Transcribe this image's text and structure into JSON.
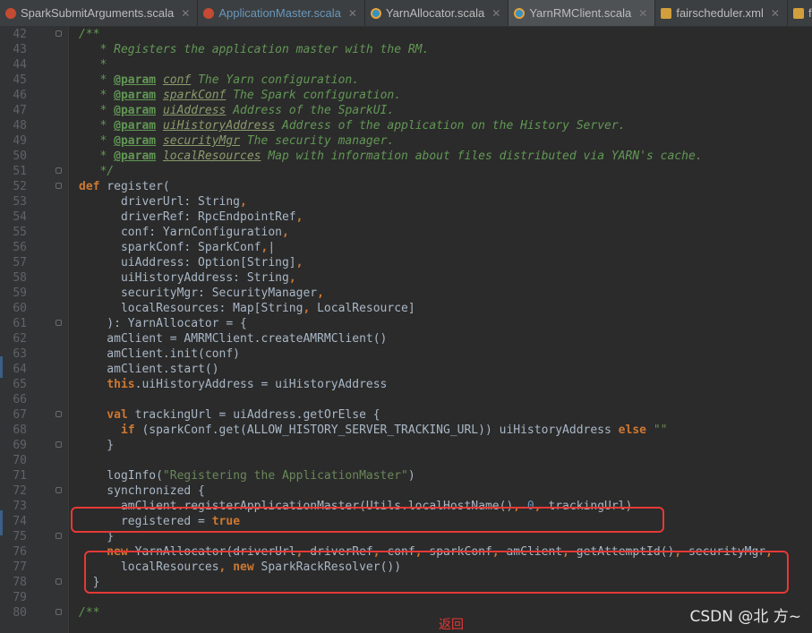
{
  "tabs": [
    {
      "label": "SparkSubmitArguments.scala",
      "icon": "scala-file-icon",
      "active": false,
      "modified": false
    },
    {
      "label": "ApplicationMaster.scala",
      "icon": "scala-file-icon",
      "active": false,
      "modified": true
    },
    {
      "label": "YarnAllocator.scala",
      "icon": "scala-class-icon",
      "active": false,
      "modified": false
    },
    {
      "label": "YarnRMClient.scala",
      "icon": "scala-class-icon",
      "active": true,
      "modified": false
    },
    {
      "label": "fairscheduler.xml",
      "icon": "xml-file-icon",
      "active": false,
      "modified": false
    },
    {
      "label": "fairsche",
      "icon": "xml-file-icon",
      "active": false,
      "modified": false
    }
  ],
  "close_glyph": "✕",
  "code_lines": [
    {
      "n": "42",
      "t": [
        [
          "doc",
          "/**"
        ]
      ],
      "fold": true
    },
    {
      "n": "43",
      "t": [
        [
          "doc",
          "   * Registers the application master with the RM."
        ]
      ]
    },
    {
      "n": "44",
      "t": [
        [
          "doc",
          "   *"
        ]
      ]
    },
    {
      "n": "45",
      "t": [
        [
          "doc",
          "   * "
        ],
        [
          "tag",
          "@param"
        ],
        [
          "doc",
          " "
        ],
        [
          "dref",
          "conf"
        ],
        [
          "doc",
          " The Yarn configuration."
        ]
      ]
    },
    {
      "n": "46",
      "t": [
        [
          "doc",
          "   * "
        ],
        [
          "tag",
          "@param"
        ],
        [
          "doc",
          " "
        ],
        [
          "dref",
          "sparkConf"
        ],
        [
          "doc",
          " The Spark configuration."
        ]
      ]
    },
    {
      "n": "47",
      "t": [
        [
          "doc",
          "   * "
        ],
        [
          "tag",
          "@param"
        ],
        [
          "doc",
          " "
        ],
        [
          "dref",
          "uiAddress"
        ],
        [
          "doc",
          " Address of the SparkUI."
        ]
      ]
    },
    {
      "n": "48",
      "t": [
        [
          "doc",
          "   * "
        ],
        [
          "tag",
          "@param"
        ],
        [
          "doc",
          " "
        ],
        [
          "dref",
          "uiHistoryAddress"
        ],
        [
          "doc",
          " Address of the application on the History Server."
        ]
      ]
    },
    {
      "n": "49",
      "t": [
        [
          "doc",
          "   * "
        ],
        [
          "tag",
          "@param"
        ],
        [
          "doc",
          " "
        ],
        [
          "dref",
          "securityMgr"
        ],
        [
          "doc",
          " The security manager."
        ]
      ]
    },
    {
      "n": "50",
      "t": [
        [
          "doc",
          "   * "
        ],
        [
          "tag",
          "@param"
        ],
        [
          "doc",
          " "
        ],
        [
          "dref",
          "localResources"
        ],
        [
          "doc",
          " Map with information about files distributed via YARN's cache."
        ]
      ]
    },
    {
      "n": "51",
      "t": [
        [
          "doc",
          "   */"
        ]
      ],
      "fold": true
    },
    {
      "n": "52",
      "t": [
        [
          "kw",
          "def"
        ],
        [
          "p",
          " register("
        ]
      ],
      "fold": true
    },
    {
      "n": "53",
      "t": [
        [
          "p",
          "      driverUrl: String"
        ],
        [
          "kw",
          ","
        ]
      ]
    },
    {
      "n": "54",
      "t": [
        [
          "p",
          "      driverRef: RpcEndpointRef"
        ],
        [
          "kw",
          ","
        ]
      ]
    },
    {
      "n": "55",
      "t": [
        [
          "p",
          "      conf: YarnConfiguration"
        ],
        [
          "kw",
          ","
        ]
      ]
    },
    {
      "n": "56",
      "t": [
        [
          "p",
          "      sparkConf: SparkConf"
        ],
        [
          "kw",
          ","
        ],
        [
          "p",
          "|"
        ]
      ]
    },
    {
      "n": "57",
      "t": [
        [
          "p",
          "      uiAddress: Option[String]"
        ],
        [
          "kw",
          ","
        ]
      ]
    },
    {
      "n": "58",
      "t": [
        [
          "p",
          "      uiHistoryAddress: String"
        ],
        [
          "kw",
          ","
        ]
      ]
    },
    {
      "n": "59",
      "t": [
        [
          "p",
          "      securityMgr: SecurityManager"
        ],
        [
          "kw",
          ","
        ]
      ]
    },
    {
      "n": "60",
      "t": [
        [
          "p",
          "      localResources: Map[String"
        ],
        [
          "kw",
          ","
        ],
        [
          "p",
          " LocalResource]"
        ]
      ]
    },
    {
      "n": "61",
      "t": [
        [
          "p",
          "    ): YarnAllocator = {"
        ]
      ],
      "fold": true
    },
    {
      "n": "62",
      "t": [
        [
          "p",
          "    amClient = AMRMClient.createAMRMClient()"
        ]
      ]
    },
    {
      "n": "63",
      "t": [
        [
          "p",
          "    amClient.init(conf)"
        ]
      ]
    },
    {
      "n": "64",
      "t": [
        [
          "p",
          "    amClient.start()"
        ]
      ]
    },
    {
      "n": "65",
      "t": [
        [
          "kw",
          "    this"
        ],
        [
          "p",
          ".uiHistoryAddress = uiHistoryAddress"
        ]
      ]
    },
    {
      "n": "66",
      "t": [
        [
          "p",
          ""
        ]
      ]
    },
    {
      "n": "67",
      "t": [
        [
          "kw",
          "    val"
        ],
        [
          "p",
          " trackingUrl = uiAddress.getOrElse {"
        ]
      ],
      "fold": true
    },
    {
      "n": "68",
      "t": [
        [
          "kw",
          "      if"
        ],
        [
          "p",
          " (sparkConf.get(ALLOW_HISTORY_SERVER_TRACKING_URL)) uiHistoryAddress "
        ],
        [
          "kw",
          "else"
        ],
        [
          "p",
          " "
        ],
        [
          "str",
          "\"\""
        ]
      ]
    },
    {
      "n": "69",
      "t": [
        [
          "p",
          "    }"
        ]
      ],
      "fold": true
    },
    {
      "n": "70",
      "t": [
        [
          "p",
          ""
        ]
      ]
    },
    {
      "n": "71",
      "t": [
        [
          "p",
          "    logInfo("
        ],
        [
          "str",
          "\"Registering the ApplicationMaster\""
        ],
        [
          "p",
          ")"
        ]
      ]
    },
    {
      "n": "72",
      "t": [
        [
          "p",
          "    synchronized {"
        ]
      ],
      "fold": true
    },
    {
      "n": "73",
      "t": [
        [
          "p",
          "      amClient.registerApplicationMaster(Utils.localHostName()"
        ],
        [
          "kw",
          ","
        ],
        [
          "p",
          " "
        ],
        [
          "num",
          "0"
        ],
        [
          "kw",
          ","
        ],
        [
          "p",
          " trackingUrl)"
        ]
      ]
    },
    {
      "n": "74",
      "t": [
        [
          "p",
          "      registered = "
        ],
        [
          "kw",
          "true"
        ]
      ]
    },
    {
      "n": "75",
      "t": [
        [
          "p",
          "    }"
        ]
      ],
      "fold": true
    },
    {
      "n": "76",
      "t": [
        [
          "kw",
          "    new"
        ],
        [
          "p",
          " YarnAllocator(driverUrl"
        ],
        [
          "kw",
          ","
        ],
        [
          "p",
          " driverRef"
        ],
        [
          "kw",
          ","
        ],
        [
          "p",
          " conf"
        ],
        [
          "kw",
          ","
        ],
        [
          "p",
          " sparkConf"
        ],
        [
          "kw",
          ","
        ],
        [
          "p",
          " amClient"
        ],
        [
          "kw",
          ","
        ],
        [
          "p",
          " getAttemptId()"
        ],
        [
          "kw",
          ","
        ],
        [
          "p",
          " securityMgr"
        ],
        [
          "kw",
          ","
        ]
      ]
    },
    {
      "n": "77",
      "t": [
        [
          "p",
          "      localResources"
        ],
        [
          "kw",
          ","
        ],
        [
          "kw",
          " new"
        ],
        [
          "p",
          " SparkRackResolver())"
        ]
      ]
    },
    {
      "n": "78",
      "t": [
        [
          "p",
          "  }"
        ]
      ],
      "fold": true
    },
    {
      "n": "79",
      "t": [
        [
          "p",
          ""
        ]
      ]
    },
    {
      "n": "80",
      "t": [
        [
          "doc",
          "/**"
        ]
      ],
      "fold": true
    }
  ],
  "back_link": "返回",
  "watermark": "CSDN @北 方~"
}
